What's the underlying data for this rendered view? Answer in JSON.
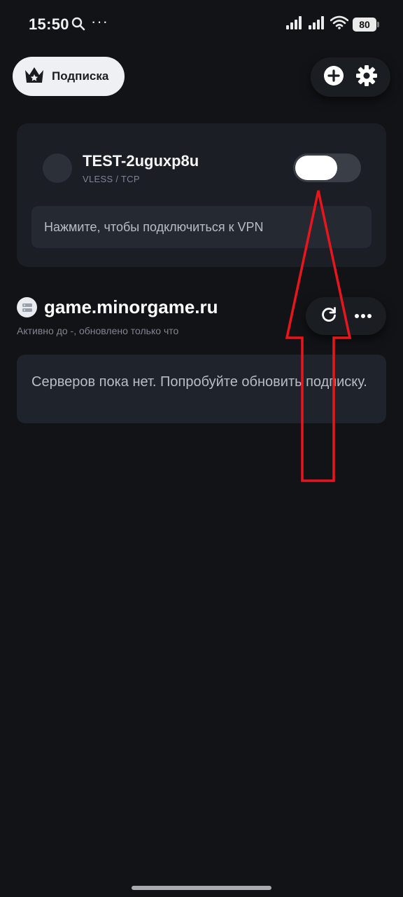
{
  "status_bar": {
    "time": "15:50",
    "battery": "80",
    "icons": [
      "search-icon",
      "more-dots-icon",
      "signal-icon",
      "signal-icon",
      "wifi-icon",
      "battery-icon"
    ]
  },
  "header": {
    "subscription_button": "Подписка",
    "subscription_icon": "crown-icon",
    "add_icon": "plus-circle-icon",
    "settings_icon": "gear-icon"
  },
  "connection": {
    "profile_name": "TEST-2uguxp8u",
    "protocol": "VLESS / TCP",
    "toggle_on": false,
    "hint": "Нажмите, чтобы подключиться к VPN"
  },
  "subscription": {
    "domain": "game.minorgame.ru",
    "meta": "Активно до -, обновлено только что",
    "refresh_icon": "refresh-icon",
    "more_icon": "more-horizontal-icon",
    "empty_message": "Серверов пока нет. Попробуйте обновить подписку."
  },
  "colors": {
    "background": "#121316",
    "card": "#1b1e24",
    "annotation": "#e8161c"
  }
}
